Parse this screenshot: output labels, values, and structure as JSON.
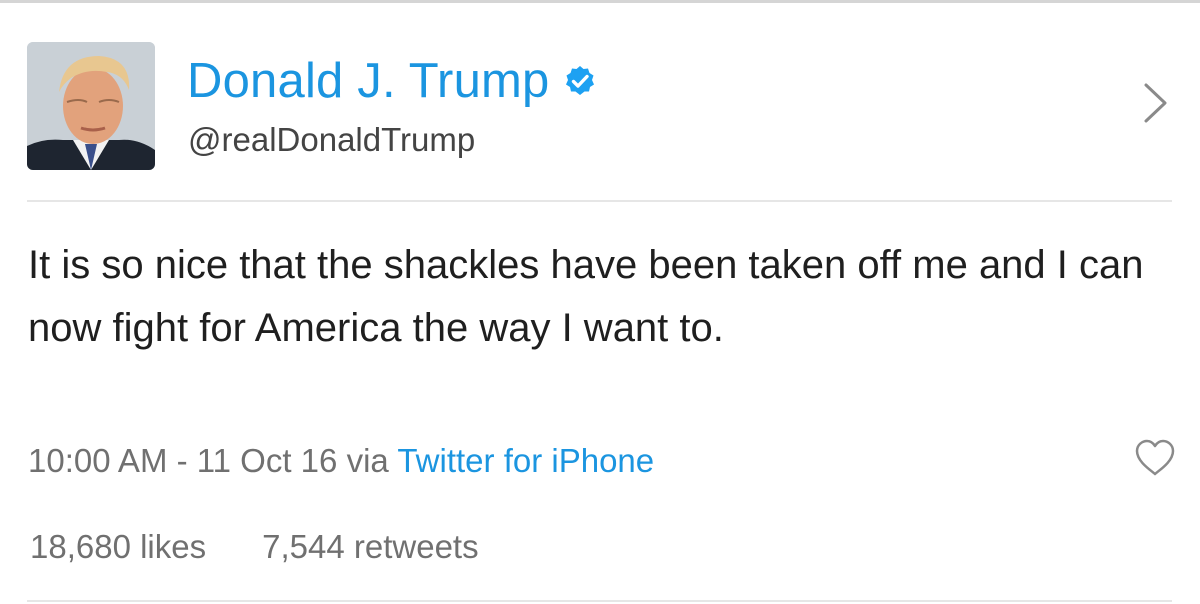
{
  "tweet": {
    "author": {
      "display_name": "Donald J. Trump",
      "handle": "@realDonaldTrump",
      "verified_icon": "verified-badge-icon",
      "avatar_icon": "profile-avatar"
    },
    "text": "It is so nice that the shackles have been taken off me and I can now fight for America the way I want to.",
    "meta": {
      "timestamp": "10:00 AM - 11 Oct 16",
      "via_label": "via",
      "source": "Twitter for iPhone"
    },
    "stats": {
      "likes": "18,680 likes",
      "retweets": "7,544 retweets"
    }
  },
  "icons": {
    "chevron": "chevron-right-icon",
    "heart": "heart-icon"
  },
  "colors": {
    "link": "#1b95e0",
    "text": "#1f1f1f",
    "secondary": "#707070",
    "divider": "#e6e6e6"
  }
}
